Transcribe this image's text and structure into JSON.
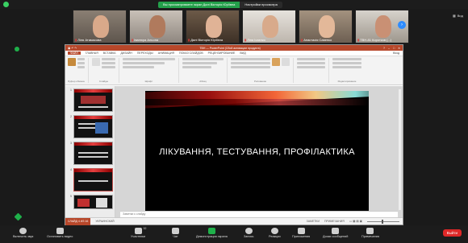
{
  "top": {
    "share_message": "Вы просматриваете экран Далі Вікторія Юріївна",
    "share_options": "Настройки просмотра",
    "view_label": "Вид"
  },
  "participants": [
    {
      "name": "Ліля Атамасова"
    },
    {
      "name": "Іванюра Альона"
    },
    {
      "name": "Далі Вікторія Юріївна"
    },
    {
      "name": "Ліна Ісаєнко"
    },
    {
      "name": "Анастасія Савенко"
    },
    {
      "name": "ТВН-81 Коротков (...)"
    }
  ],
  "ppt": {
    "title": "ТВН — PowerPoint (Сбой активации продукта)",
    "tabs": [
      "ФАЙЛ",
      "ГЛАВНАЯ",
      "ВСТАВКА",
      "ДИЗАЙН",
      "ПЕРЕХОДЫ",
      "АНИМАЦИЯ",
      "ПОКАЗ СЛАЙДОВ",
      "РЕЦЕНЗИРОВАНИЕ",
      "ВИД"
    ],
    "ribbon_groups": [
      "Буфер обмена",
      "Слайды",
      "Шрифт",
      "Абзац",
      "Рисование",
      "Редактирование"
    ],
    "sign_in": "Вход",
    "slide_numbers": [
      "1",
      "2",
      "3",
      "4",
      "5"
    ],
    "slide_title": "ЛІКУВАННЯ, ТЕСТУВАННЯ, ПРОФІЛАКТИКА",
    "notes_placeholder": "Заметки к слайду",
    "status_left": "СЛАЙД 4 ИЗ 16",
    "status_lang": "УКРАИНСКИЙ",
    "status_notes": "ЗАМЕТКИ",
    "status_comments": "ПРИМЕЧАНИЯ"
  },
  "toolbar": {
    "audio": "Включить звук",
    "video": "Остановить видео",
    "participants": "Участники",
    "participants_count": "52",
    "chat": "Чат",
    "share": "Демонстрация экрана",
    "record": "Запись",
    "reactions": "Реакции",
    "apps": "Приложения",
    "whiteboard": "Доски сообщений",
    "notes": "Примечания",
    "leave": "Выйти"
  }
}
